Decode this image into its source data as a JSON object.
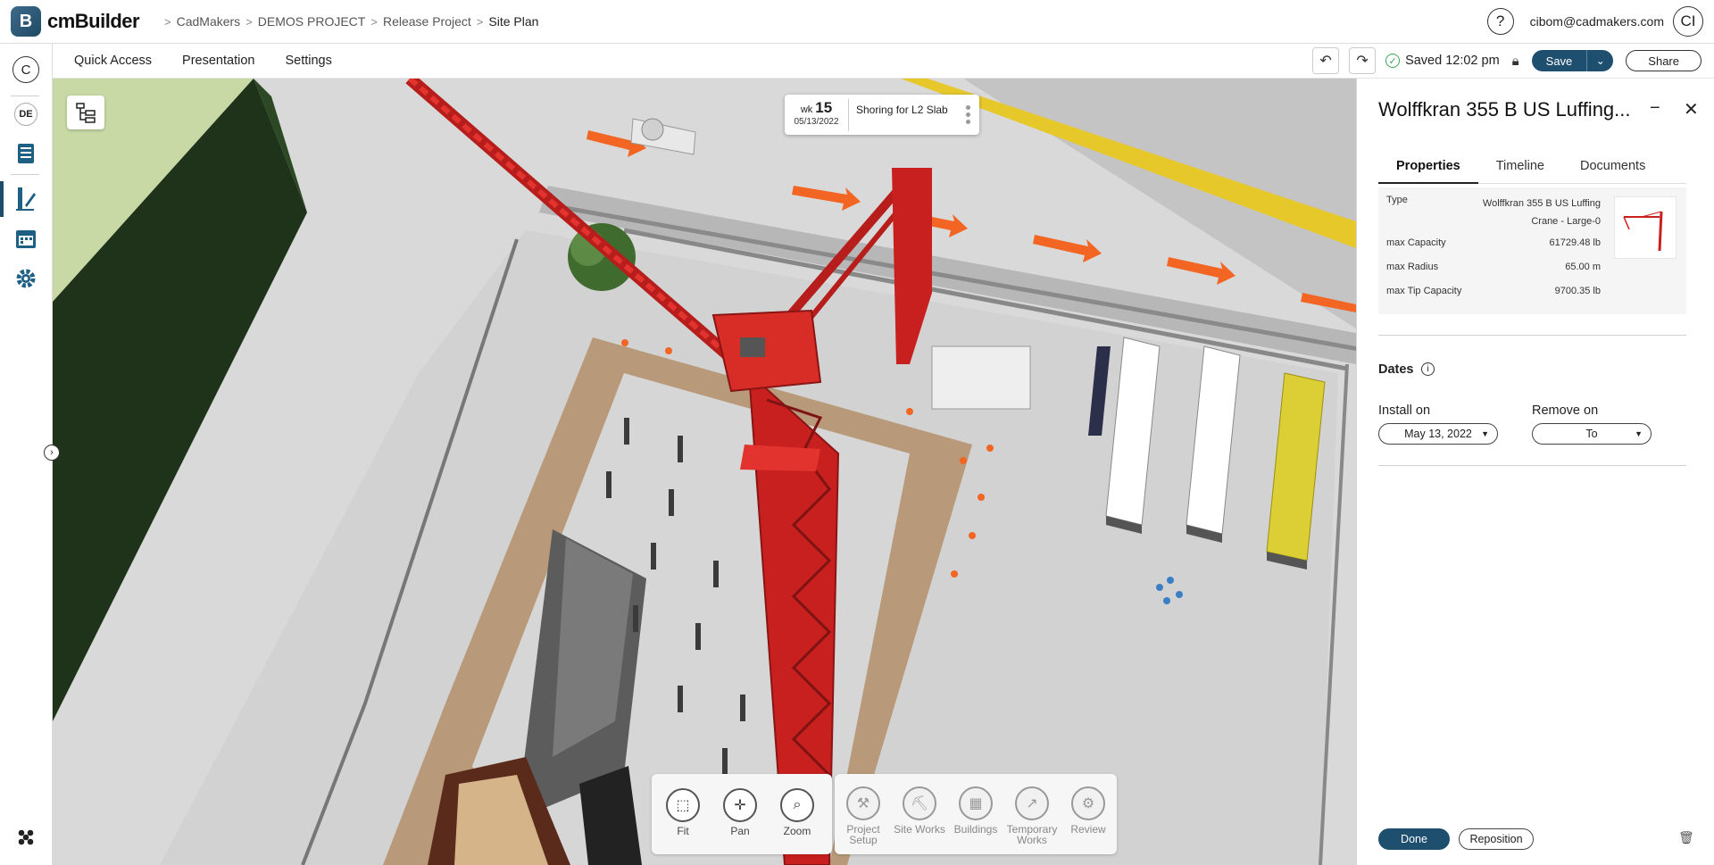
{
  "app": {
    "logo_letter": "B",
    "name": "cmBuilder"
  },
  "breadcrumb": [
    "CadMakers",
    "DEMOS PROJECT",
    "Release Project",
    "Site Plan"
  ],
  "header": {
    "help_glyph": "?",
    "user_email": "cibom@cadmakers.com",
    "user_initials": "CI"
  },
  "left_rail": {
    "org_initial": "C",
    "workspace_badge": "DE"
  },
  "subbar": {
    "tabs": [
      "Quick Access",
      "Presentation",
      "Settings"
    ],
    "saved_text": "Saved 12:02 pm",
    "save_label": "Save",
    "share_label": "Share"
  },
  "task_card": {
    "wk_prefix": "wk",
    "wk_number": "15",
    "date": "05/13/2022",
    "title": "Shoring for L2 Slab"
  },
  "nav_tools": [
    {
      "label": "Fit"
    },
    {
      "label": "Pan"
    },
    {
      "label": "Zoom"
    }
  ],
  "site_tools": [
    {
      "label": "Project Setup"
    },
    {
      "label": "Site Works"
    },
    {
      "label": "Buildings"
    },
    {
      "label": "Temporary Works"
    },
    {
      "label": "Review"
    }
  ],
  "panel": {
    "title": "Wolffkran 355 B US Luffing...",
    "tabs": [
      "Properties",
      "Timeline",
      "Documents"
    ],
    "active_tab": "Properties",
    "properties": [
      {
        "key": "Type",
        "value_line1": "Wolffkran 355 B US Luffing",
        "value_line2": "Crane - Large-0"
      },
      {
        "key": "max Capacity",
        "value": "61729.48 lb"
      },
      {
        "key": "max Radius",
        "value": "65.00 m"
      },
      {
        "key": "max Tip Capacity",
        "value": "9700.35 lb"
      }
    ],
    "dates_label": "Dates",
    "install_label": "Install on",
    "install_value": "May 13, 2022",
    "remove_label": "Remove on",
    "remove_value": "To",
    "done_label": "Done",
    "reposition_label": "Reposition"
  },
  "colors": {
    "brand": "#1e4f6e",
    "crane": "#c8201e",
    "arrow": "#f26522",
    "saved": "#3aa35a"
  }
}
